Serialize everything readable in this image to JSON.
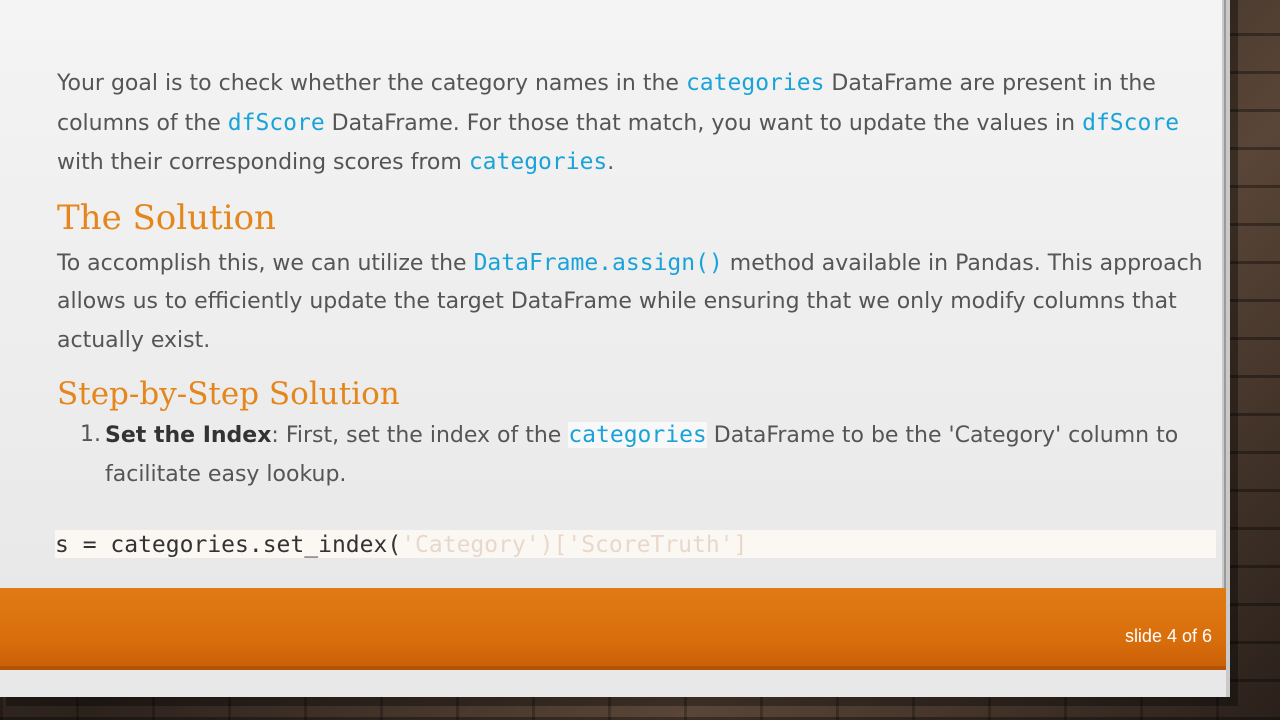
{
  "intro": {
    "t1": "Your goal is to check whether the category names in the ",
    "c1": "categories",
    "t2": " DataFrame are present in the columns of the ",
    "c2": "dfScore",
    "t3": " DataFrame. For those that match, you want to update the values in ",
    "c3": "dfScore",
    "t4": " with their corresponding scores from ",
    "c4": "categories",
    "t5": "."
  },
  "solution": {
    "heading": "The Solution",
    "t1": "To accomplish this, we can utilize the ",
    "c1": "DataFrame.assign()",
    "t2": " method available in Pandas. This approach allows us to efficiently update the target DataFrame while ensuring that we only modify columns that actually exist."
  },
  "steps": {
    "heading": "Step-by-Step Solution",
    "items": [
      {
        "num": "1.",
        "bold": "Set the Index",
        "t1": ": First, set the index of the ",
        "c1": "categories",
        "t2": " DataFrame to be the 'Category' column to facilitate easy lookup."
      }
    ]
  },
  "code": {
    "visible": "s = categories.set_index(",
    "faded": "'Category')['ScoreTruth']"
  },
  "footer": {
    "slide_label": "slide 4 of 6"
  },
  "colors": {
    "accent": "#e5861c",
    "code": "#1aa3d9",
    "footer": "#d96f0c"
  }
}
